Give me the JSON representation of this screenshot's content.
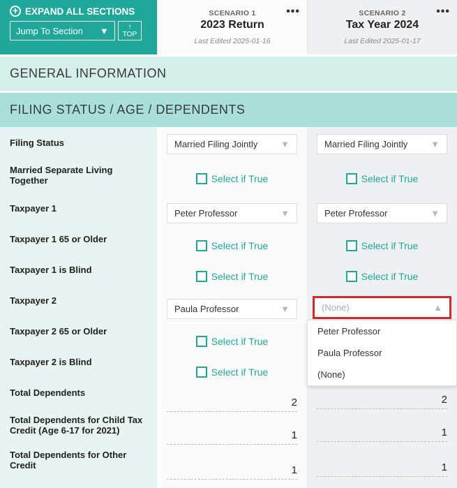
{
  "header": {
    "expand_all": "EXPAND ALL SECTIONS",
    "jump_to_section": "Jump To Section",
    "top_btn": "TOP"
  },
  "scenarios": [
    {
      "label": "SCENARIO 1",
      "title": "2023 Return",
      "edited": "Last Edited 2025-01-16"
    },
    {
      "label": "SCENARIO 2",
      "title": "Tax Year 2024",
      "edited": "Last Edited 2025-01-17"
    }
  ],
  "sections": {
    "general_info": "GENERAL INFORMATION",
    "filing_status": "FILING STATUS / AGE / DEPENDENTS"
  },
  "labels": {
    "filing_status": "Filing Status",
    "msep": "Married Separate Living Together",
    "tp1": "Taxpayer 1",
    "tp1_65": "Taxpayer 1 65 or Older",
    "tp1_blind": "Taxpayer 1 is Blind",
    "tp2": "Taxpayer 2",
    "tp2_65": "Taxpayer 2 65 or Older",
    "tp2_blind": "Taxpayer 2 is Blind",
    "total_dep": "Total Dependents",
    "total_ctc": "Total Dependents for Child Tax Credit (Age 6-17 for 2021)",
    "total_other": "Total Dependents for Other Credit"
  },
  "select_if_true": "Select if True",
  "values": {
    "filing_status": {
      "s1": "Married Filing Jointly",
      "s2": "Married Filing Jointly"
    },
    "tp1": {
      "s1": "Peter Professor",
      "s2": "Peter Professor"
    },
    "tp2": {
      "s1": "Paula Professor",
      "s2_placeholder": "(None)"
    },
    "total_dep": {
      "s1": "2",
      "s2": "2"
    },
    "total_ctc": {
      "s1": "1",
      "s2": "1"
    },
    "total_other": {
      "s1": "1",
      "s2": "1"
    }
  },
  "dropdown_options": {
    "tp2_s2": [
      "Peter Professor",
      "Paula Professor",
      "(None)"
    ]
  }
}
